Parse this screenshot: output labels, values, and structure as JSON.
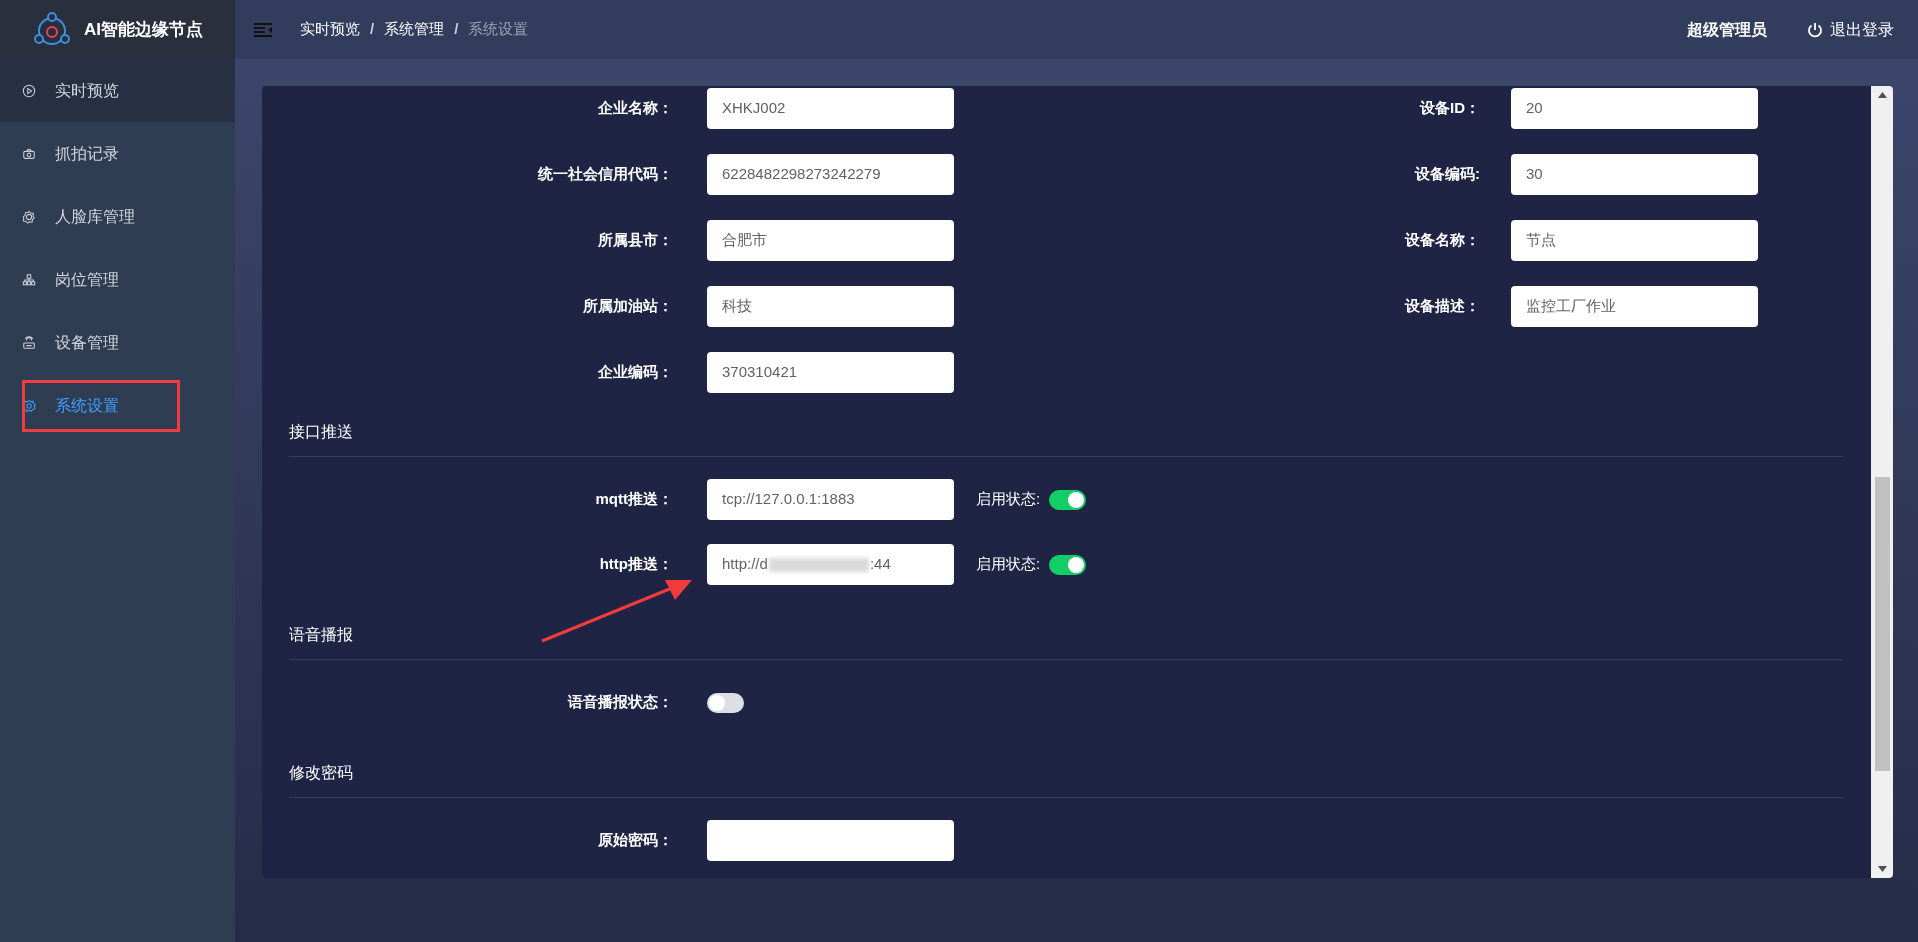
{
  "app": {
    "title": "AI智能边缘节点"
  },
  "breadcrumb": {
    "separator": "/",
    "items": [
      {
        "label": "实时预览",
        "current": false
      },
      {
        "label": "系统管理",
        "current": false
      },
      {
        "label": "系统设置",
        "current": true
      }
    ]
  },
  "user": {
    "name": "超级管理员",
    "logout": "退出登录"
  },
  "sidebar": {
    "items": [
      {
        "label": "实时预览",
        "hovered": true,
        "selected": false,
        "annotated": false
      },
      {
        "label": "抓拍记录",
        "hovered": false,
        "selected": false,
        "annotated": false
      },
      {
        "label": "人脸库管理",
        "hovered": false,
        "selected": false,
        "annotated": false
      },
      {
        "label": "岗位管理",
        "hovered": false,
        "selected": false,
        "annotated": false
      },
      {
        "label": "设备管理",
        "hovered": false,
        "selected": false,
        "annotated": false
      },
      {
        "label": "系统设置",
        "hovered": false,
        "selected": true,
        "annotated": true
      }
    ]
  },
  "basic": {
    "left": [
      {
        "label": "企业名称：",
        "value": "XHKJ002"
      },
      {
        "label": "统一社会信用代码：",
        "value": "6228482298273242279"
      },
      {
        "label": "所属县市：",
        "value": "合肥市"
      },
      {
        "label": "所属加油站：",
        "value": "科技"
      },
      {
        "label": "企业编码：",
        "value": "370310421"
      }
    ],
    "right": [
      {
        "label": "设备ID：",
        "value": "20"
      },
      {
        "label": "设备编码:",
        "value": "30"
      },
      {
        "label": "设备名称：",
        "value": "节点"
      },
      {
        "label": "设备描述：",
        "value": "监控工厂作业"
      }
    ]
  },
  "sections": [
    {
      "title": "接口推送",
      "rows": [
        {
          "kind": "url_switch",
          "label": "mqtt推送：",
          "value": "tcp://127.0.0.1:1883",
          "obscured": false,
          "switch_label": "启用状态:",
          "on": true
        },
        {
          "kind": "url_switch",
          "label": "http推送：",
          "value": "http://d",
          "value_tail": ":44",
          "obscured": true,
          "switch_label": "启用状态:",
          "on": true
        }
      ]
    },
    {
      "title": "语音播报",
      "rows": [
        {
          "kind": "switch",
          "label": "语音播报状态：",
          "on": false
        }
      ]
    },
    {
      "title": "修改密码",
      "rows": [
        {
          "kind": "input",
          "label": "原始密码："
        }
      ]
    }
  ],
  "annotations": [
    {
      "kind": "arrow"
    }
  ]
}
